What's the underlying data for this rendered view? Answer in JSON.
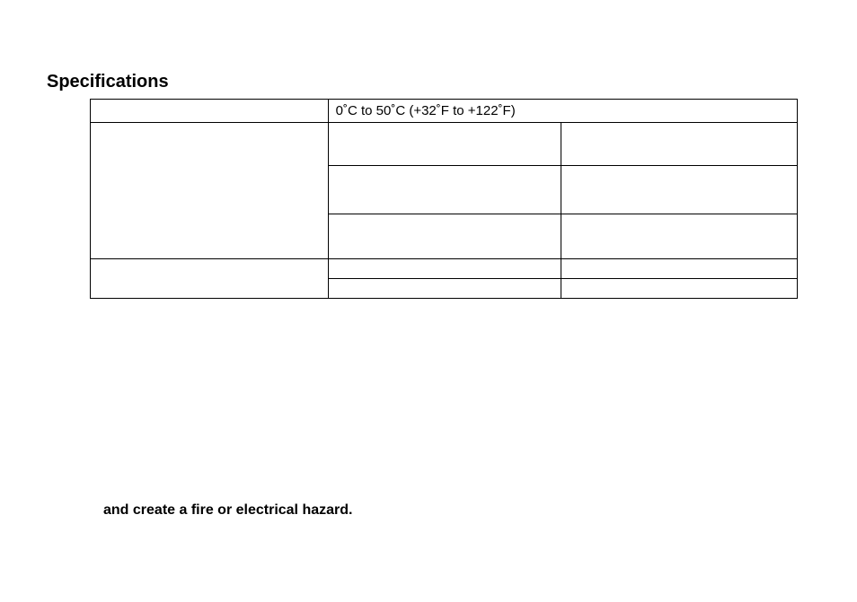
{
  "title": "Specifications",
  "table": {
    "rows": [
      {
        "a": "",
        "b": "0˚C to 50˚C (+32˚F to +122˚F)",
        "c": null
      },
      {
        "a": "",
        "b": "",
        "c": ""
      },
      {
        "a": null,
        "b": "",
        "c": ""
      },
      {
        "a": null,
        "b": "",
        "c": ""
      },
      {
        "a": "",
        "b": "",
        "c": ""
      },
      {
        "a": null,
        "b": "",
        "c": ""
      }
    ]
  },
  "hazard": "and create a fire or electrical hazard."
}
